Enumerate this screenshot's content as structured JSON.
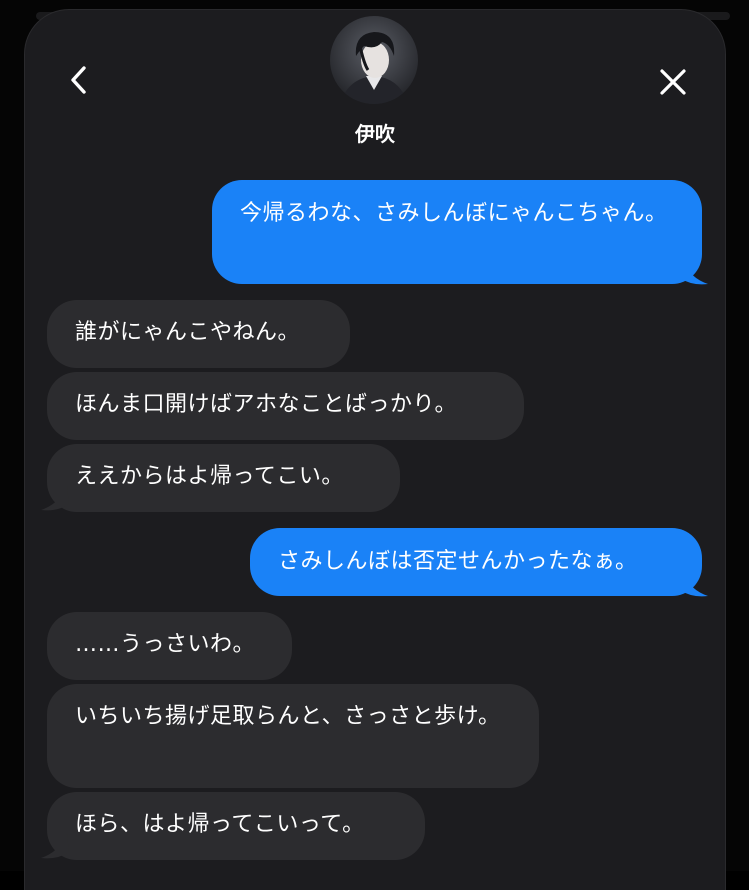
{
  "contact": {
    "name": "伊吹"
  },
  "header": {
    "back_icon": "chevron-left-icon",
    "close_icon": "close-icon"
  },
  "colors": {
    "outgoing_bubble": "#1a82f7",
    "incoming_bubble": "#2c2c2f",
    "panel_background": "#1c1c1f"
  },
  "messages": [
    {
      "direction": "out",
      "text": "今帰るわな、さみしんぼにゃんこちゃん。"
    },
    {
      "direction": "in",
      "text": "誰がにゃんこやねん。"
    },
    {
      "direction": "in",
      "text": "ほんま口開けばアホなことばっかり。"
    },
    {
      "direction": "in",
      "text": "ええからはよ帰ってこい。"
    },
    {
      "direction": "out",
      "text": "さみしんぼは否定せんかったなぁ。"
    },
    {
      "direction": "in",
      "text": "……うっさいわ。"
    },
    {
      "direction": "in",
      "text": "いちいち揚げ足取らんと、さっさと歩け。"
    },
    {
      "direction": "in",
      "text": "ほら、はよ帰ってこいって。"
    }
  ]
}
